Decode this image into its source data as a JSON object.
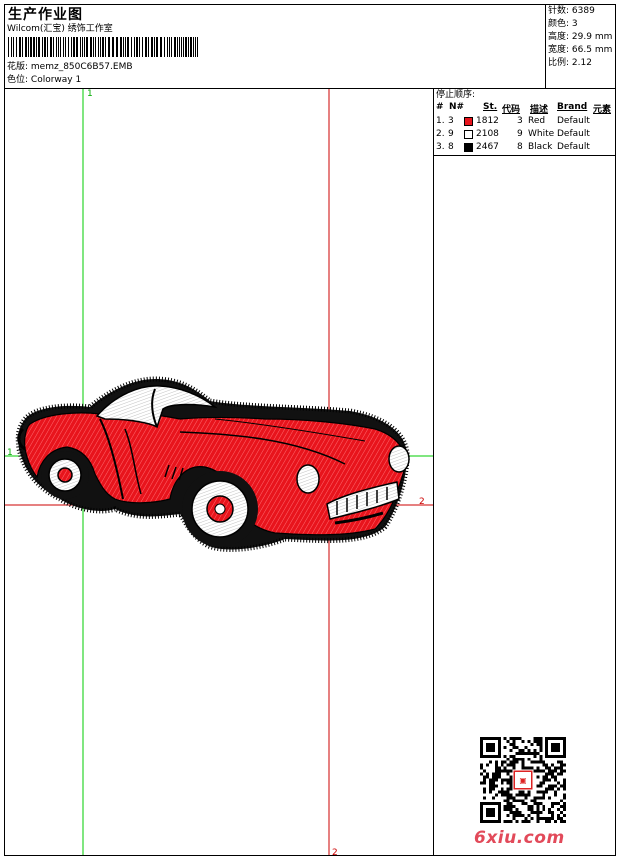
{
  "header": {
    "title": "生产作业图",
    "software": "Wilcom(汇宝) 绣饰工作室",
    "file_label": "花版: ",
    "file_name": "memz_850C6B57.EMB",
    "colorway_label": "色位: ",
    "colorway": "Colorway 1"
  },
  "stats": [
    {
      "label": "针数:",
      "value": "6389"
    },
    {
      "label": "颜色:",
      "value": "3"
    },
    {
      "label": "高度:",
      "value": "29.9 mm"
    },
    {
      "label": "宽度:",
      "value": "66.5 mm"
    },
    {
      "label": "比例:",
      "value": "2.12"
    }
  ],
  "stop_sequence": {
    "title": "停止顺序:",
    "columns": [
      "#",
      "N#",
      "St.",
      "代码",
      "描述",
      "Brand",
      "元素"
    ],
    "rows": [
      {
        "index": "1.",
        "n": "3",
        "color": "#e8141c",
        "stitches": "1812",
        "code": "3",
        "description": "Red",
        "brand": "Default"
      },
      {
        "index": "2.",
        "n": "9",
        "color": "#ffffff",
        "stitches": "2108",
        "code": "9",
        "description": "White",
        "brand": "Default"
      },
      {
        "index": "3.",
        "n": "8",
        "color": "#000000",
        "stitches": "2467",
        "code": "8",
        "description": "Black",
        "brand": "Default"
      }
    ]
  },
  "design": {
    "guide_markers": {
      "top": "1",
      "left": "1",
      "right": "2",
      "bottom": "2"
    },
    "guide_colors": {
      "green": "#00cc00",
      "red": "#cc0000"
    }
  },
  "watermark": {
    "brand": "6xiu.com"
  }
}
